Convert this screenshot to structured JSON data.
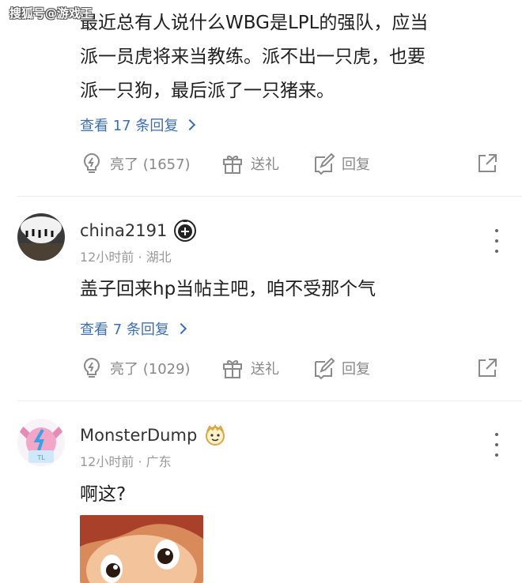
{
  "watermark": "搜狐号@游戏王",
  "comment1": {
    "lines": [
      "最近总有人说什么WBG是LPL的强队，应当",
      "派一员虎将来当教练。派不出一只虎，也要",
      "派一只狗，最后派了一只猪来。"
    ],
    "view_replies": "查看 17 条回复",
    "like_label": "亮了 (1657)",
    "gift_label": "送礼",
    "reply_label": "回复"
  },
  "comment2": {
    "username": "china2191",
    "time": "12小时前",
    "location": "湖北",
    "text": "盖子回来hp当帖主吧，咱不受那个气",
    "view_replies": "查看 7 条回复",
    "like_label": "亮了 (1029)",
    "gift_label": "送礼",
    "reply_label": "回复",
    "badge_icon": "team-logo-badge-icon"
  },
  "comment3": {
    "username": "MonsterDump",
    "time": "12小时前",
    "location": "广东",
    "text": "啊这?",
    "badge_icon": "emoji-badge-icon"
  },
  "colors": {
    "link": "#3d6fb0",
    "muted": "#999999",
    "action": "#888888"
  }
}
